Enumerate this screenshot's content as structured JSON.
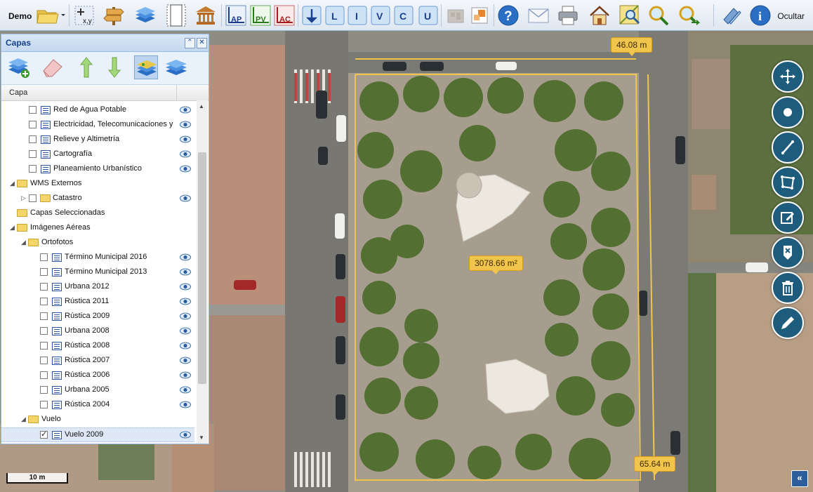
{
  "toolbar": {
    "demo_label": "Demo",
    "hide_label": "Ocultar",
    "tools": [
      {
        "id": "folder",
        "icon": "folder-icon"
      },
      {
        "id": "coords",
        "icon": "coordinates-xy-icon",
        "text": "x,y"
      },
      {
        "id": "signpost",
        "icon": "signpost-icon"
      },
      {
        "id": "layers",
        "icon": "layers-icon"
      },
      {
        "id": "frame",
        "icon": "print-frame-icon"
      },
      {
        "id": "museum",
        "icon": "building-icon"
      },
      {
        "id": "ap",
        "icon": "ap-tool-icon",
        "text": "AP"
      },
      {
        "id": "pv",
        "icon": "pv-tool-icon",
        "text": "PV"
      },
      {
        "id": "ac",
        "icon": "ac-tool-icon",
        "text": "AC"
      },
      {
        "id": "b1",
        "icon": "blue-tool-1-icon"
      },
      {
        "id": "l",
        "icon": "tool-l-icon",
        "text": "L"
      },
      {
        "id": "i",
        "icon": "tool-i-icon",
        "text": "I"
      },
      {
        "id": "v",
        "icon": "tool-v-icon",
        "text": "V"
      },
      {
        "id": "c",
        "icon": "tool-c-icon",
        "text": "C"
      },
      {
        "id": "u",
        "icon": "tool-u-icon",
        "text": "U"
      },
      {
        "id": "disabled",
        "icon": "disabled-tool-icon"
      },
      {
        "id": "edit-geom",
        "icon": "edit-geometry-icon"
      },
      {
        "id": "help",
        "icon": "help-icon",
        "text": "?"
      },
      {
        "id": "mail",
        "icon": "mail-icon"
      },
      {
        "id": "print",
        "icon": "print-icon"
      },
      {
        "id": "home",
        "icon": "home-icon"
      },
      {
        "id": "zoom-area",
        "icon": "zoom-area-icon"
      },
      {
        "id": "zoom-in",
        "icon": "zoom-in-icon"
      },
      {
        "id": "zoom-next",
        "icon": "zoom-next-icon"
      },
      {
        "id": "legend",
        "icon": "legend-icon"
      },
      {
        "id": "info",
        "icon": "info-icon",
        "text": "i"
      }
    ]
  },
  "panel": {
    "title": "Capas",
    "column_header": "Capa",
    "tools": [
      "add-layer-icon",
      "eraser-icon",
      "move-up-icon",
      "move-down-icon",
      "layers-active-icon",
      "layers-stack-icon"
    ],
    "tree": [
      {
        "label": "Red de Agua Potable",
        "type": "layer",
        "level": 2,
        "checked": false,
        "eye": true
      },
      {
        "label": "Electricidad, Telecomunicaciones y G",
        "type": "layer",
        "level": 2,
        "checked": false,
        "eye": true
      },
      {
        "label": "Relieve y Altimetría",
        "type": "layer",
        "level": 2,
        "checked": false,
        "eye": true
      },
      {
        "label": "Cartografía",
        "type": "layer",
        "level": 2,
        "checked": false,
        "eye": true
      },
      {
        "label": "Planeamiento Urbanístico",
        "type": "layer",
        "level": 2,
        "checked": false,
        "eye": true
      },
      {
        "label": "WMS Externos",
        "type": "folder",
        "level": 0,
        "expanded": true
      },
      {
        "label": "Catastro",
        "type": "folder-check",
        "level": 1,
        "checked": false,
        "eye": true
      },
      {
        "label": "Capas Seleccionadas",
        "type": "folder",
        "level": 0,
        "expanded": null
      },
      {
        "label": "Imágenes Aéreas",
        "type": "folder",
        "level": 0,
        "expanded": true
      },
      {
        "label": "Ortofotos",
        "type": "folder",
        "level": 1,
        "expanded": true
      },
      {
        "label": "Término Municipal 2016",
        "type": "layer",
        "level": 3,
        "checked": false,
        "eye": true
      },
      {
        "label": "Término Municipal 2013",
        "type": "layer",
        "level": 3,
        "checked": false,
        "eye": true
      },
      {
        "label": "Urbana 2012",
        "type": "layer",
        "level": 3,
        "checked": false,
        "eye": true
      },
      {
        "label": "Rústica 2011",
        "type": "layer",
        "level": 3,
        "checked": false,
        "eye": true
      },
      {
        "label": "Rústica 2009",
        "type": "layer",
        "level": 3,
        "checked": false,
        "eye": true
      },
      {
        "label": "Urbana 2008",
        "type": "layer",
        "level": 3,
        "checked": false,
        "eye": true
      },
      {
        "label": "Rústica 2008",
        "type": "layer",
        "level": 3,
        "checked": false,
        "eye": true
      },
      {
        "label": "Rústica 2007",
        "type": "layer",
        "level": 3,
        "checked": false,
        "eye": true
      },
      {
        "label": "Rústica 2006",
        "type": "layer",
        "level": 3,
        "checked": false,
        "eye": true
      },
      {
        "label": "Urbana 2005",
        "type": "layer",
        "level": 3,
        "checked": false,
        "eye": true
      },
      {
        "label": "Rústica 2004",
        "type": "layer",
        "level": 3,
        "checked": false,
        "eye": true
      },
      {
        "label": "Vuelo",
        "type": "folder",
        "level": 1,
        "expanded": true
      },
      {
        "label": "Vuelo 2009",
        "type": "layer",
        "level": 3,
        "checked": true,
        "eye": true,
        "selected": true
      }
    ]
  },
  "map": {
    "measure_top": "46.08 m",
    "measure_area": "3078.66 m²",
    "measure_right": "65.64 m",
    "scale_label": "10 m",
    "collapse_label": "«",
    "measure_color": "#f1c44b"
  },
  "map_controls": [
    "pan-icon",
    "point-icon",
    "line-icon",
    "polygon-icon",
    "edit-icon",
    "delete-vertex-icon",
    "trash-icon",
    "pencil-icon"
  ]
}
